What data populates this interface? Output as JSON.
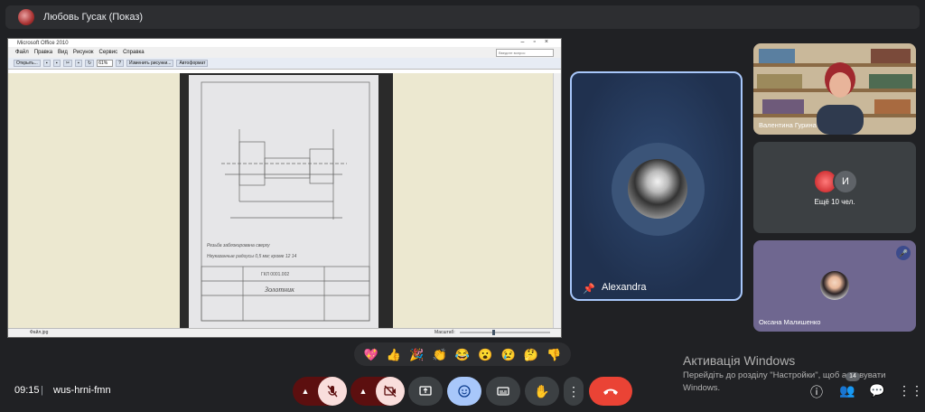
{
  "presenter": {
    "title": "Любовь Гусак (Показ)"
  },
  "shared_screen": {
    "window_title": "Microsoft Office 2010",
    "menu": [
      "Файл",
      "Правка",
      "Вид",
      "Рисунок",
      "Сервис",
      "Справка"
    ],
    "ask_placeholder": "Введите вопрос",
    "toolbar": {
      "open_label": "Открыть...",
      "zoom": "61%",
      "edit_picture": "Изменить рисунки...",
      "autoformat": "Автоформат"
    },
    "status": {
      "filename": "Файл.jpg",
      "zoom_label": "Масштаб:"
    },
    "drawing": {
      "lines": [
        "Резьба заблокирована сверху",
        "Неуказанные радиусы 0,5 мм; кроме 12 14"
      ],
      "title": "Золотник",
      "stamp": "ГКЛ 0001.002"
    }
  },
  "main_tile": {
    "name": "Alexandra"
  },
  "tiles": [
    {
      "name": "Валентина Гурина"
    },
    {
      "more_label": "Ещё 10 чел.",
      "avatar_letter": "И"
    },
    {
      "name": "Оксана Малишенко"
    }
  ],
  "reactions": [
    "💖",
    "👍",
    "🎉",
    "👏",
    "😂",
    "😮",
    "😢",
    "🤔",
    "👎"
  ],
  "watermark": {
    "title": "Активація Windows",
    "text": "Перейдіть до розділу \"Настройки\", щоб активувати Windows."
  },
  "bottom_bar": {
    "time": "09:15",
    "separator": "|",
    "meeting_code": "wus-hrni-fmn"
  },
  "people_count": "14"
}
